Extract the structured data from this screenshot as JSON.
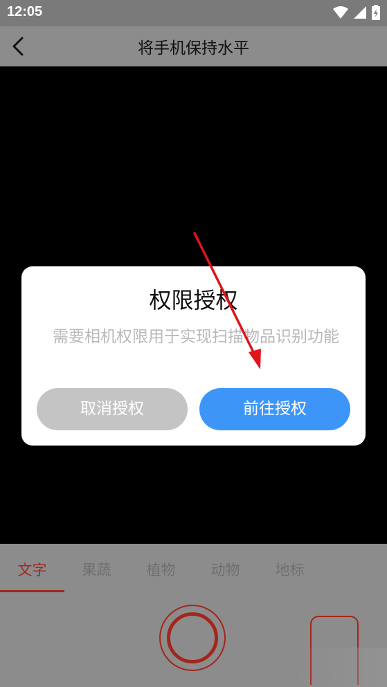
{
  "status_bar": {
    "time": "12:05"
  },
  "app_bar": {
    "title": "将手机保持水平"
  },
  "dialog": {
    "title": "权限授权",
    "message": "需要相机权限用于实现扫描物品识别功能",
    "cancel_label": "取消授权",
    "confirm_label": "前往授权"
  },
  "tabs": [
    {
      "label": "文字",
      "active": true
    },
    {
      "label": "果蔬",
      "active": false
    },
    {
      "label": "植物",
      "active": false
    },
    {
      "label": "动物",
      "active": false
    },
    {
      "label": "地标",
      "active": false
    }
  ],
  "colors": {
    "accent": "#a3261c",
    "primary_button": "#3d96f7",
    "cancel_button": "#c4c4c4",
    "annotation_arrow": "#e0141b"
  }
}
